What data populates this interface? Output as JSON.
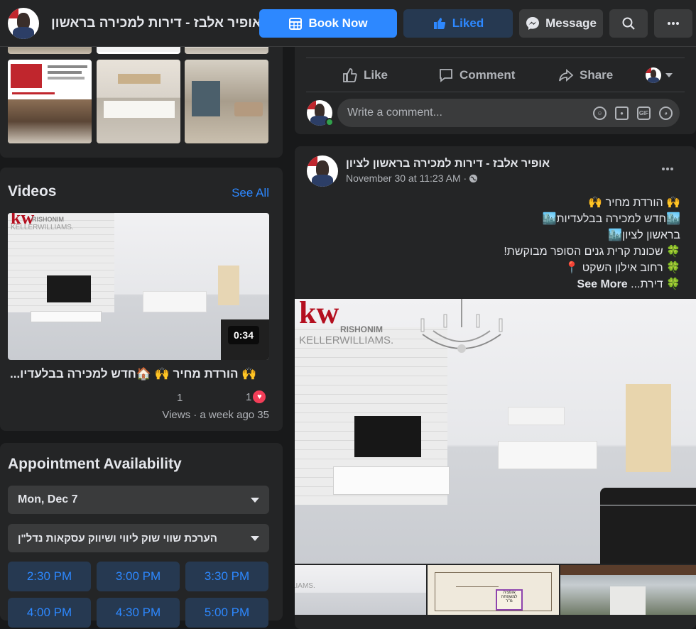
{
  "header": {
    "page_title": "אופיר אלבז - דירות למכירה בראשון...",
    "book_now": "Book Now",
    "liked": "Liked",
    "message": "Message"
  },
  "videos": {
    "title": "Videos",
    "see_all": "See All",
    "duration": "0:34",
    "video_title": "🙌 הורדת מחיר 🙌 🏠חדש למכירה בבלעדיו...",
    "comment_count": "1",
    "reaction_count": "1",
    "meta": "Views · a week ago 35"
  },
  "appointment": {
    "title": "Appointment Availability",
    "date_value": "Mon, Dec 7",
    "service_value": "הערכת שווי שוק ליווי ושיווק עסקאות נדל\"ן",
    "slots": [
      "2:30 PM",
      "3:00 PM",
      "3:30 PM",
      "4:00 PM",
      "4:30 PM",
      "5:00 PM"
    ]
  },
  "post_actions": {
    "like": "Like",
    "comment": "Comment",
    "share": "Share",
    "comment_placeholder": "Write a comment..."
  },
  "post": {
    "author": "אופיר אלבז - דירות למכירה בראשון לציון",
    "timestamp": "November 30 at 11:23 AM · ",
    "lines": [
      "🙌 הורדת מחיר 🙌",
      "🏙️חדש למכירה בבלעדיות🏙️",
      "בראשון לציון🏙️",
      "🍀 שכונת קרית גנים הסופר מבוקשת!",
      "🍀 רחוב אילון השקט 📍"
    ],
    "last_line": "🍀 דירת...",
    "see_more": "See More"
  },
  "image_text": {
    "kw": "kw",
    "rishonim": "RISHONIM",
    "keller": "KELLERWILLIAMS.",
    "floorplan_note": "אופציה\nלמשפחה\nמ\"ר"
  },
  "colors": {
    "background": "#18191a",
    "card": "#242526",
    "accent": "#2d88ff",
    "kw_red": "#b40f1f"
  }
}
